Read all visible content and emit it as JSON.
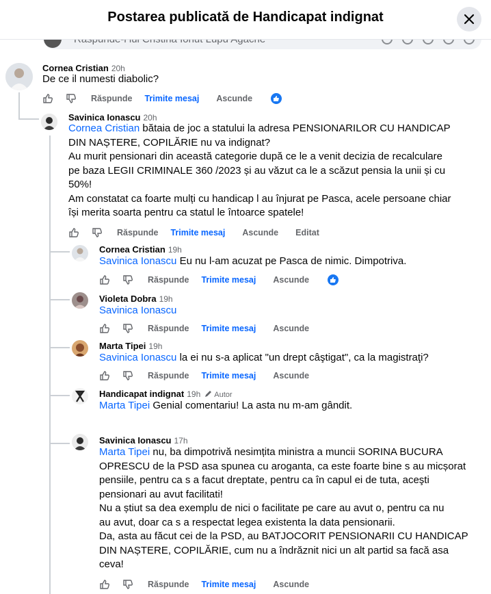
{
  "header": {
    "title": "Postarea publicată de Handicapat indignat"
  },
  "reply_box": {
    "placeholder": "Răspunde-i lui Cristina Ionut Lupu Agache"
  },
  "actions": {
    "reply": "Răspunde",
    "message": "Trimite mesaj",
    "hide": "Ascunde",
    "edited": "Editat"
  },
  "colors": {
    "accent": "#0866ff",
    "like": "#1877f2",
    "text": "#050505",
    "muted": "#65676b",
    "bubble": "#f0f2f5"
  },
  "comments": [
    {
      "author": "Cornea Cristian",
      "time": "20h",
      "text": "De ce il numesti diabolic?"
    },
    {
      "author": "Savinica Ionascu",
      "time": "20h",
      "mention": "Cornea Cristian",
      "lines": [
        "bătaia de joc a statului la adresa PENSIONARILOR CU HANDICAP",
        "DIN NAȘTERE, COPILĂRIE nu va indignat?",
        "Au murit pensionari din această categorie după ce le a venit decizia de recalculare",
        "pe baza LEGII CRIMINALE 360 /2023 și au văzut ca le a scăzut pensia la unii și cu",
        "50%!",
        "Am constatat ca foarte mulți cu handicap l au înjurat pe Pasca, acele persoane chiar",
        "își merita soarta pentru ca statul le întoarce spatele!"
      ]
    },
    {
      "author": "Cornea Cristian",
      "time": "19h",
      "mention": "Savinica Ionascu",
      "text": "Eu nu l-am acuzat pe Pasca de nimic. Dimpotriva."
    },
    {
      "author": "Violeta Dobra",
      "time": "19h",
      "mention": "Savinica Ionascu",
      "text": ""
    },
    {
      "author": "Marta Tipei",
      "time": "19h",
      "mention": "Savinica Ionascu",
      "text": "la ei nu s-a aplicat \"un drept câştigat\", ca la magistraţi?"
    },
    {
      "author": "Handicapat indignat",
      "time": "19h",
      "badge": "Autor",
      "mention": "Marta Tipei",
      "text": "Genial comentariu! La asta nu m-am gândit."
    },
    {
      "author": "Savinica Ionascu",
      "time": "17h",
      "mention": "Marta Tipei",
      "lines": [
        "nu, ba dimpotrivă nesimțita ministra a muncii SORINA BUCURA",
        "OPRESCU de la PSD asa spunea cu aroganta, ca este foarte bine s au micșorat",
        "pensiile, pentru ca s a facut dreptate, pentru ca în capul ei de tuta, aceşti",
        "pensionari au avut facilitati!",
        "Nu a știut sa dea exemplu de nici o facilitate pe care au avut o, pentru ca nu",
        "au avut, doar ca s a respectat legea existenta la data pensionarii.",
        "Da, asta au făcut cei de la PSD, au BATJOCORIT PENSIONARII CU HANDICAP",
        "DIN NAȘTERE, COPILĂRIE, cum nu a îndrăznit nici un alt partid sa facă asa",
        "ceva!"
      ]
    }
  ]
}
